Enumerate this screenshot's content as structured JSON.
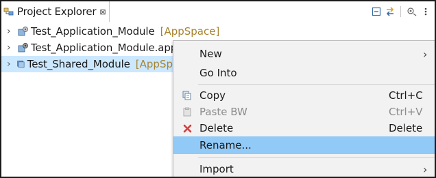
{
  "view": {
    "title": "Project Explorer",
    "close_glyph": "⊠",
    "toolbar": [
      {
        "icon": "collapse-all-icon"
      },
      {
        "icon": "link-with-editor-icon"
      },
      {
        "icon": "filters-icon"
      },
      {
        "icon": "view-menu-icon"
      }
    ]
  },
  "tree": {
    "items": [
      {
        "label": "Test_Application_Module",
        "decoration": "[AppSpace]",
        "icon": "application-module-icon",
        "expanded": false,
        "selected": false
      },
      {
        "label": "Test_Application_Module.app",
        "decoration": "",
        "icon": "application-module-app-icon",
        "expanded": false,
        "selected": false
      },
      {
        "label": "Test_Shared_Module",
        "decoration": "[AppSp",
        "icon": "shared-module-icon",
        "expanded": false,
        "selected": true
      }
    ]
  },
  "context_menu": {
    "items": [
      {
        "label": "New",
        "accelerator": "",
        "submenu": true,
        "icon": "",
        "enabled": true
      },
      {
        "label": "Go Into",
        "accelerator": "",
        "submenu": false,
        "icon": "",
        "enabled": true
      },
      {
        "label": "Copy",
        "accelerator": "Ctrl+C",
        "submenu": false,
        "icon": "copy-icon",
        "enabled": true
      },
      {
        "label": "Paste BW",
        "accelerator": "Ctrl+V",
        "submenu": false,
        "icon": "paste-icon",
        "enabled": false
      },
      {
        "label": "Delete",
        "accelerator": "Delete",
        "submenu": false,
        "icon": "delete-icon",
        "enabled": true
      },
      {
        "label": "Rename...",
        "accelerator": "",
        "submenu": false,
        "icon": "",
        "enabled": true,
        "highlighted": true
      },
      {
        "label": "Import",
        "accelerator": "",
        "submenu": true,
        "icon": "",
        "enabled": true
      }
    ]
  },
  "colors": {
    "selection": "#cce8ff",
    "menu_highlight": "#91c9f7",
    "decoration": "#a8832f",
    "delete_icon": "#d43b3b"
  }
}
